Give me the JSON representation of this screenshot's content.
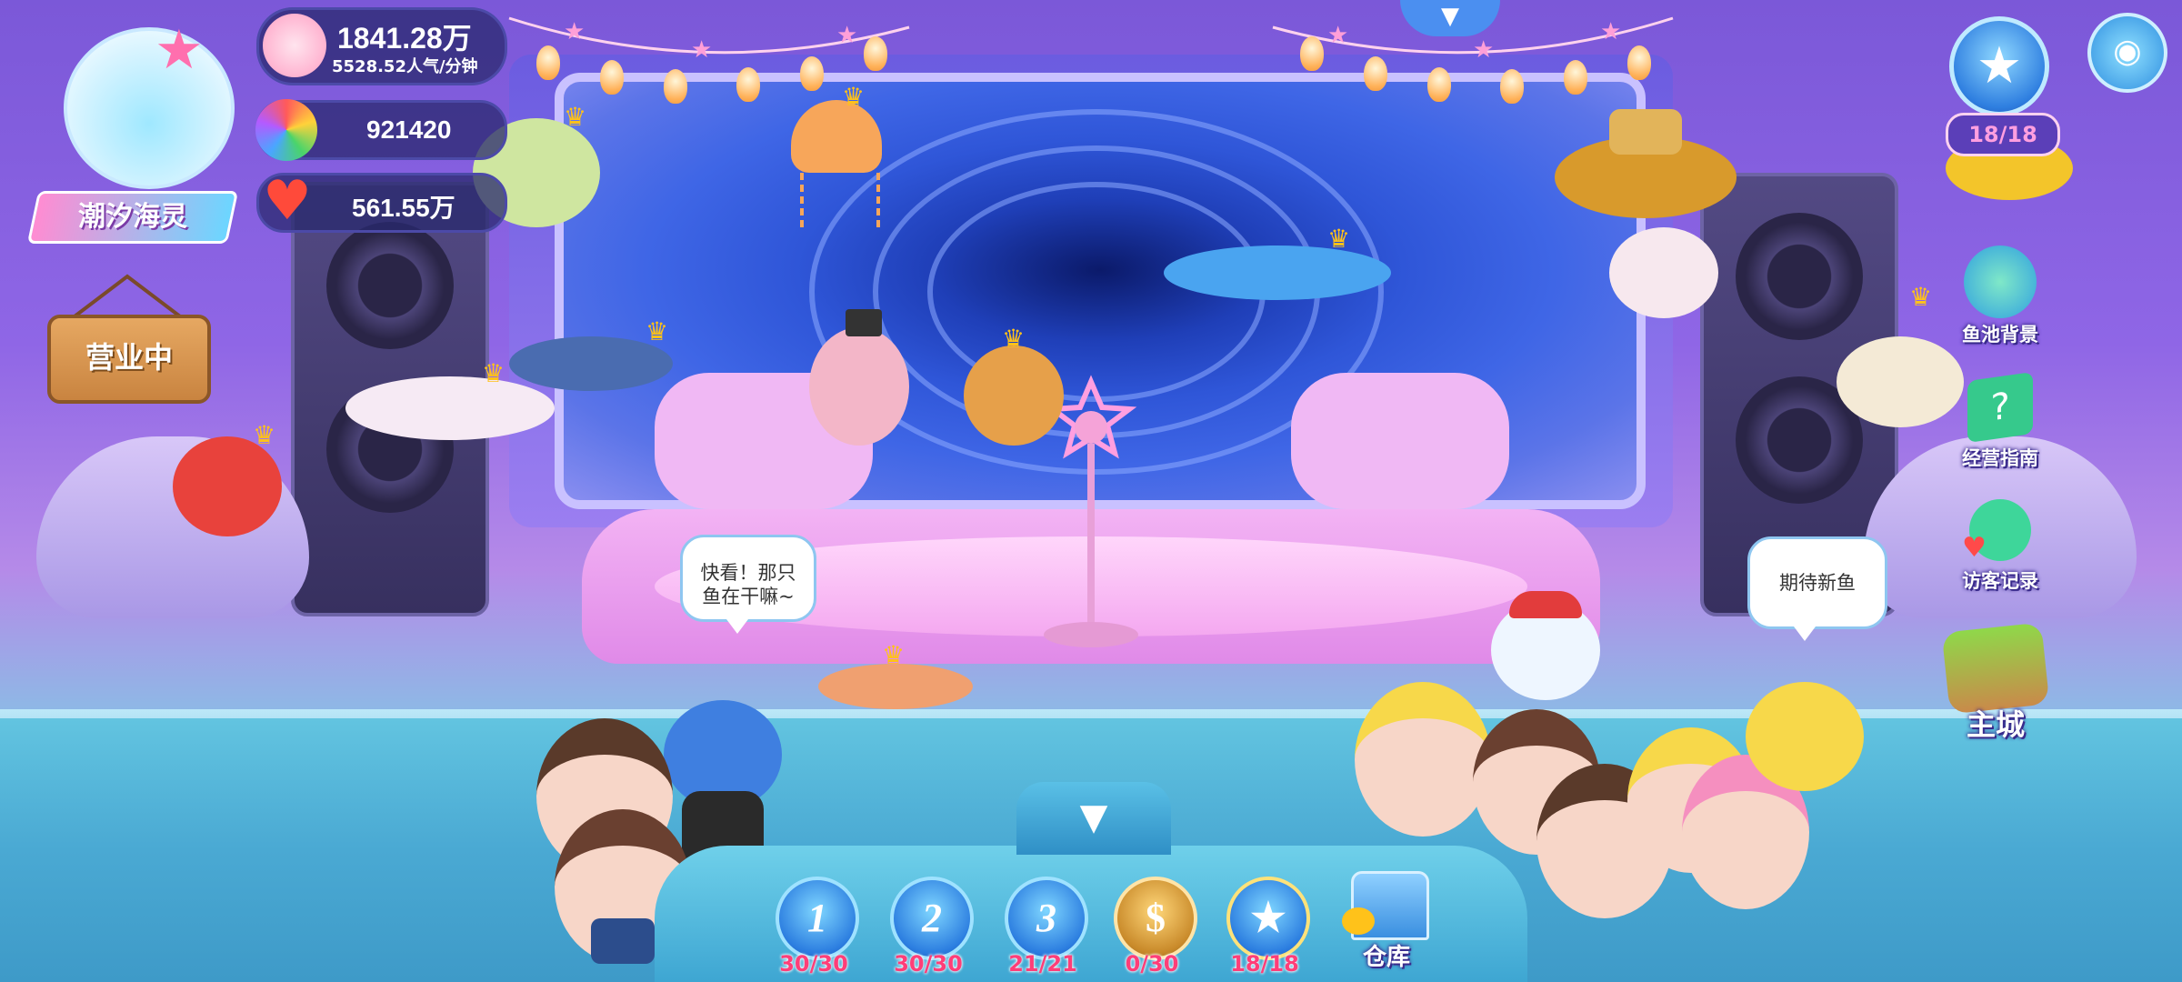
{
  "hud": {
    "badge_title": "潮汐海灵",
    "shop_sign": "营业中",
    "popularity_total": "1841.28万",
    "popularity_rate": "5528.52人气/分钟",
    "coins": "921420",
    "hearts": "561.55万"
  },
  "top_right": {
    "star_count": "18/18"
  },
  "side_menu": {
    "items": [
      {
        "label": "鱼池背景",
        "icon": "palm-tank-icon"
      },
      {
        "label": "经营指南",
        "icon": "guide-book-icon"
      },
      {
        "label": "访客记录",
        "icon": "visitor-icon"
      },
      {
        "label": "主城",
        "icon": "island-icon"
      }
    ]
  },
  "speech": {
    "left": "快看！那只鱼在干嘛~",
    "right": "期待新鱼"
  },
  "dock": {
    "tabs": [
      {
        "label": "1",
        "count": "30/30",
        "icon": "tank-1-icon"
      },
      {
        "label": "2",
        "count": "30/30",
        "icon": "tank-2-icon"
      },
      {
        "label": "3",
        "count": "21/21",
        "icon": "tank-3-icon"
      },
      {
        "label": "$",
        "count": "0/30",
        "icon": "coin-tank-icon"
      },
      {
        "label": "★",
        "count": "18/18",
        "icon": "star-tank-icon"
      }
    ],
    "warehouse": "仓库"
  },
  "colors": {
    "count_text": "#ff3e78",
    "accent": "#ffc21a"
  }
}
